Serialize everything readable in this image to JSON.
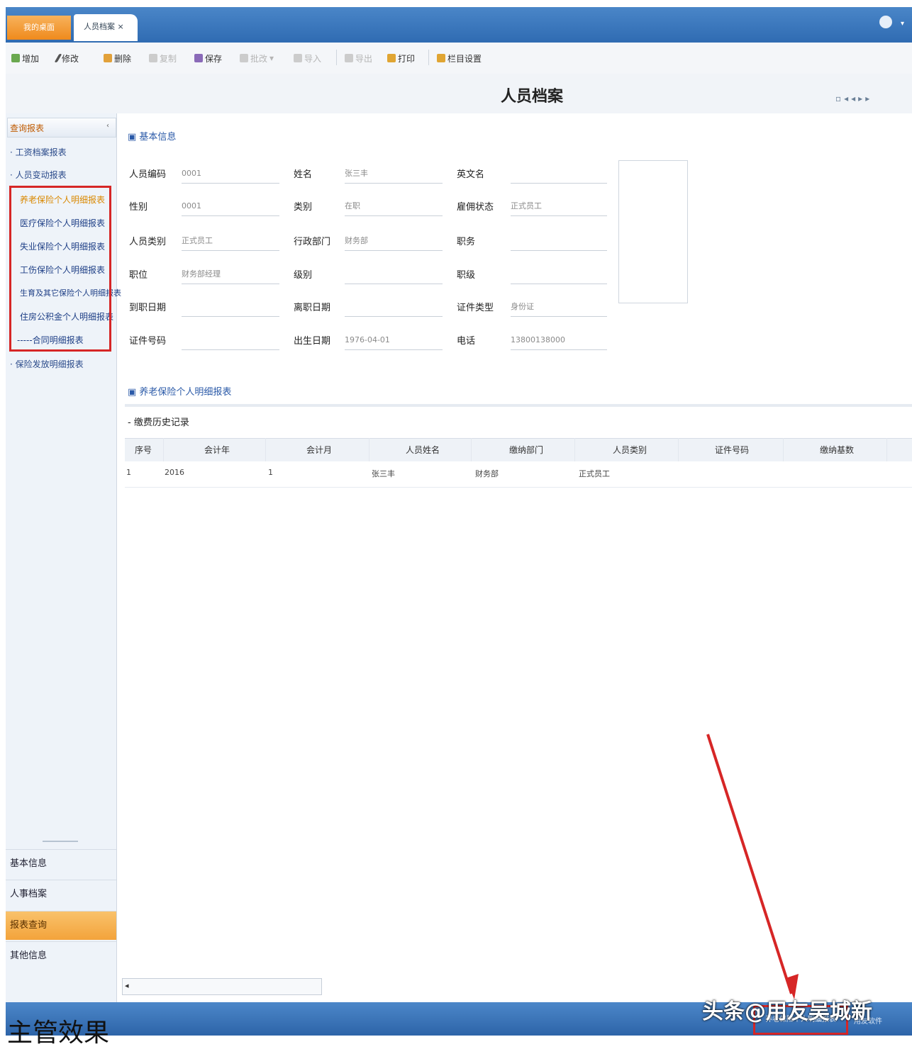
{
  "tabs": {
    "home": "我的桌面",
    "active": "人员档案"
  },
  "toolbar": {
    "add": "增加",
    "edit": "修改",
    "delete": "删除",
    "copy": "复制",
    "save": "保存",
    "batch": "批改",
    "import": "导入",
    "export": "导出",
    "print": "打印",
    "grid_settings": "栏目设置"
  },
  "page_title": "人员档案",
  "nav_arrows": "▫◂◂▸▸",
  "sidebar": {
    "header": "查询报表",
    "items": [
      "· 工资档案报表",
      "· 人员变动报表",
      "养老保险个人明细报表",
      "医疗保险个人明细报表",
      "失业保险个人明细报表",
      "工伤保险个人明细报表",
      "生育及其它保险个人明细报表",
      "住房公积金个人明细报表",
      "-----合同明细报表",
      "· 保险发放明细报表"
    ],
    "bottom": [
      "基本信息",
      "人事档案",
      "报表查询",
      "其他信息"
    ]
  },
  "section1": "基本信息",
  "form": {
    "emp_code_label": "人员编码",
    "emp_code": "0001",
    "name_label": "姓名",
    "name": "张三丰",
    "english_label": "英文名",
    "english": "",
    "gender_label": "性别",
    "gender": "0001",
    "type_label": "类别",
    "type": "在职",
    "dept_label": "雇佣状态",
    "dept": "正式员工",
    "category_label": "人员类别",
    "category": "正式员工",
    "office_label": "行政部门",
    "office": "财务部",
    "post_label": "职务",
    "post": "",
    "position_label": "职位",
    "position": "财务部经理",
    "level_label": "级别",
    "level": "",
    "grade_label": "职级",
    "grade": "",
    "hire_label": "到职日期",
    "hire": "",
    "leave_label": "离职日期",
    "leave": "",
    "id_type_label": "证件类型",
    "id_type": "身份证",
    "id_no_label": "证件号码",
    "id_no": "",
    "birth_label": "出生日期",
    "birth": "1976-04-01",
    "phone_label": "电话",
    "phone": "13800138000"
  },
  "section2": "养老保险个人明细报表",
  "sub_panel": "缴费历史记录",
  "grid": {
    "headers": [
      "序号",
      "会计年",
      "会计月",
      "人员姓名",
      "缴纳部门",
      "人员类别",
      "证件号码",
      "缴纳基数"
    ],
    "row": [
      "1",
      "2016",
      "1",
      "张三丰",
      "财务部",
      "正式员工",
      "",
      ""
    ]
  },
  "status_btn": "养老保险个人明细报表",
  "status_right": "用友软件",
  "watermark": "头条@用友吴城新",
  "caption": "主管效果",
  "colors": {
    "accent": "#f3a33b",
    "titlebar": "#2f6bb2",
    "highlight": "#d62626"
  }
}
